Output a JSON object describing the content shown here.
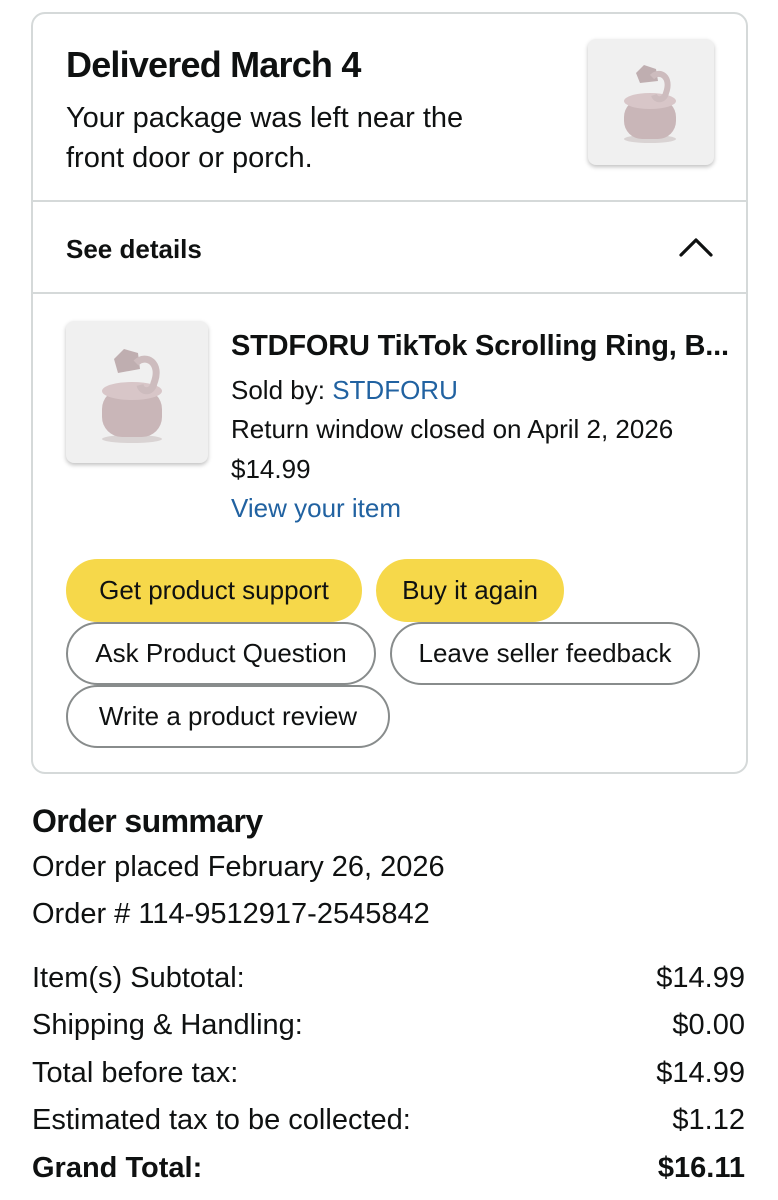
{
  "delivery": {
    "title": "Delivered March 4",
    "message": "Your package was left near the front door or porch."
  },
  "details": {
    "label": "See details",
    "icon": "chevron-up-icon"
  },
  "item": {
    "title": "STDFORU TikTok Scrolling Ring, B...",
    "sold_by_label": "Sold by:",
    "seller": "STDFORU",
    "return_window": "Return window closed on April 2, 2026",
    "price": "$14.99",
    "view_link": "View your item",
    "image_icon": "scrolling-ring-product-image"
  },
  "actions": {
    "get_support": "Get product support",
    "buy_again": "Buy it again",
    "ask_question": "Ask Product Question",
    "seller_feedback": "Leave seller feedback",
    "write_review": "Write a product review"
  },
  "summary": {
    "title": "Order summary",
    "placed": "Order placed February 26, 2026",
    "order_number": "Order # 114-9512917-2545842",
    "rows": [
      {
        "label": "Item(s) Subtotal:",
        "value": "$14.99"
      },
      {
        "label": "Shipping & Handling:",
        "value": "$0.00"
      },
      {
        "label": "Total before tax:",
        "value": "$14.99"
      },
      {
        "label": "Estimated tax to be collected:",
        "value": "$1.12"
      },
      {
        "label": "Grand Total:",
        "value": "$16.11"
      }
    ]
  },
  "colors": {
    "link": "#2162a1",
    "primary_button": "#f6d84a",
    "border": "#d5d9d9",
    "text": "#0f1111"
  }
}
